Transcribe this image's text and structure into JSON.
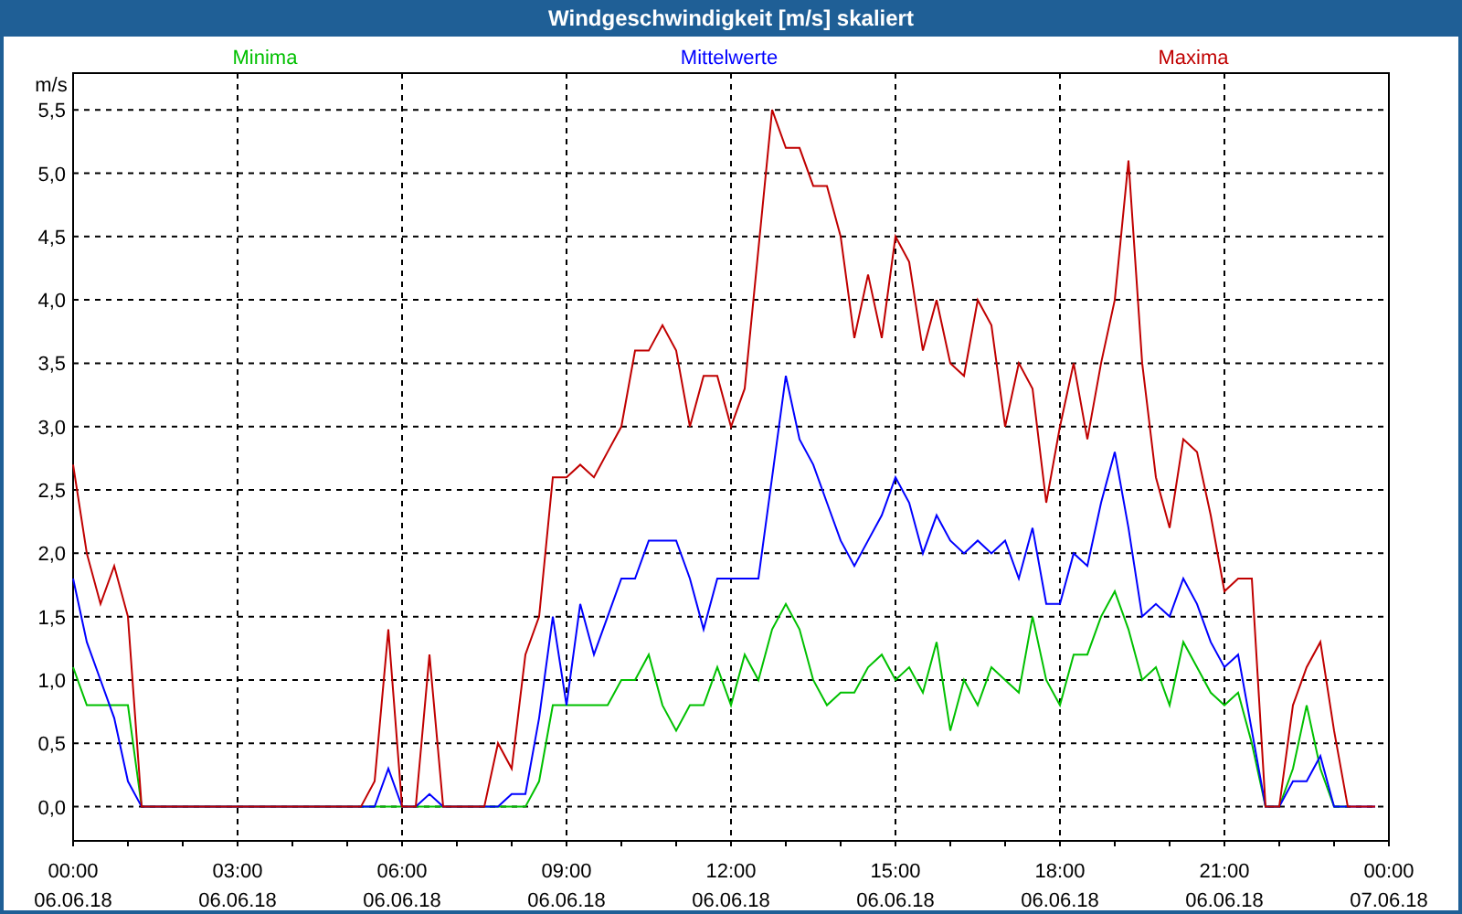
{
  "window": {
    "title": "Windgeschwindigkeit [m/s] skaliert"
  },
  "chart": {
    "chart_data": {
      "type": "line",
      "ylabel": "m/s",
      "categories": [
        "00:00\n06.06.18",
        null,
        null,
        null,
        null,
        null,
        null,
        null,
        null,
        null,
        null,
        null,
        "03:00\n06.06.18",
        null,
        null,
        null,
        null,
        null,
        null,
        null,
        null,
        null,
        null,
        null,
        "06:00\n06.06.18",
        null,
        null,
        null,
        null,
        null,
        null,
        null,
        null,
        null,
        null,
        null,
        "09:00\n06.06.18",
        null,
        null,
        null,
        null,
        null,
        null,
        null,
        null,
        null,
        null,
        null,
        "12:00\n06.06.18",
        null,
        null,
        null,
        null,
        null,
        null,
        null,
        null,
        null,
        null,
        null,
        "15:00\n06.06.18",
        null,
        null,
        null,
        null,
        null,
        null,
        null,
        null,
        null,
        null,
        null,
        "18:00\n06.06.18",
        null,
        null,
        null,
        null,
        null,
        null,
        null,
        null,
        null,
        null,
        null,
        "21:00\n06.06.18",
        null,
        null,
        null,
        null,
        null,
        null,
        null,
        null,
        null,
        null,
        null,
        "00:00\n07.06.18"
      ],
      "series": [
        {
          "name": "Minima",
          "color": "#00c000",
          "values": [
            1.1,
            0.8,
            0.8,
            0.8,
            0.8,
            0,
            0,
            0,
            0,
            0,
            0,
            0,
            0,
            0,
            0,
            0,
            0,
            0,
            0,
            0,
            0,
            0,
            0,
            0,
            0,
            0,
            0,
            0,
            0,
            0,
            0,
            0,
            0,
            0,
            0.2,
            0.8,
            0.8,
            0.8,
            0.8,
            0.8,
            1.0,
            1.0,
            1.2,
            0.8,
            0.6,
            0.8,
            0.8,
            1.1,
            0.8,
            1.2,
            1.0,
            1.4,
            1.6,
            1.4,
            1.0,
            0.8,
            0.9,
            0.9,
            1.1,
            1.2,
            1.0,
            1.1,
            0.9,
            1.3,
            0.6,
            1.0,
            0.8,
            1.1,
            1.0,
            0.9,
            1.5,
            1.0,
            0.8,
            1.2,
            1.2,
            1.5,
            1.7,
            1.4,
            1.0,
            1.1,
            0.8,
            1.3,
            1.1,
            0.9,
            0.8,
            0.9,
            0.5,
            0,
            0,
            0.3,
            0.8,
            0.3,
            0,
            0,
            null,
            null,
            null
          ]
        },
        {
          "name": "Mittelwerte",
          "color": "#0000ff",
          "values": [
            1.8,
            1.3,
            1.0,
            0.7,
            0.2,
            0,
            0,
            0,
            0,
            0,
            0,
            0,
            0,
            0,
            0,
            0,
            0,
            0,
            0,
            0,
            0,
            0,
            0,
            0.3,
            0,
            0,
            0.1,
            0,
            0,
            0,
            0,
            0,
            0.1,
            0.1,
            0.7,
            1.5,
            0.8,
            1.6,
            1.2,
            1.5,
            1.8,
            1.8,
            2.1,
            2.1,
            2.1,
            1.8,
            1.4,
            1.8,
            1.8,
            1.8,
            1.8,
            2.6,
            3.4,
            2.9,
            2.7,
            2.4,
            2.1,
            1.9,
            2.1,
            2.3,
            2.6,
            2.4,
            2.0,
            2.3,
            2.1,
            2.0,
            2.1,
            2.0,
            2.1,
            1.8,
            2.2,
            1.6,
            1.6,
            2.0,
            1.9,
            2.4,
            2.8,
            2.2,
            1.5,
            1.6,
            1.5,
            1.8,
            1.6,
            1.3,
            1.1,
            1.2,
            0.6,
            0,
            0,
            0.2,
            0.2,
            0.4,
            0,
            0,
            0,
            0,
            null
          ]
        },
        {
          "name": "Maxima",
          "color": "#c00000",
          "values": [
            2.7,
            2.0,
            1.6,
            1.9,
            1.5,
            0,
            0,
            0,
            0,
            0,
            0,
            0,
            0,
            0,
            0,
            0,
            0,
            0,
            0,
            0,
            0,
            0,
            0.2,
            1.4,
            0,
            0,
            1.2,
            0,
            0,
            0,
            0,
            0.5,
            0.3,
            1.2,
            1.5,
            2.6,
            2.6,
            2.7,
            2.6,
            2.8,
            3.0,
            3.6,
            3.6,
            3.8,
            3.6,
            3.0,
            3.4,
            3.4,
            3.0,
            3.3,
            4.4,
            5.5,
            5.2,
            5.2,
            4.9,
            4.9,
            4.5,
            3.7,
            4.2,
            3.7,
            4.5,
            4.3,
            3.6,
            4.0,
            3.5,
            3.4,
            4.0,
            3.8,
            3.0,
            3.5,
            3.3,
            2.4,
            3.0,
            3.5,
            2.9,
            3.5,
            4.0,
            5.1,
            3.5,
            2.6,
            2.2,
            2.9,
            2.8,
            2.3,
            1.7,
            1.8,
            1.8,
            0,
            0,
            0.8,
            1.1,
            1.3,
            0.6,
            0,
            0,
            0,
            null
          ]
        }
      ],
      "ylim": [
        -0.27,
        5.79
      ],
      "grid": true,
      "yticks": [
        {
          "value": 0,
          "label": "0,0"
        },
        {
          "value": 0.5,
          "label": "0,5"
        },
        {
          "value": 1,
          "label": "1,0"
        },
        {
          "value": 1.5,
          "label": "1,5"
        },
        {
          "value": 2,
          "label": "2,0"
        },
        {
          "value": 2.5,
          "label": "2,5"
        },
        {
          "value": 3,
          "label": "3,0"
        },
        {
          "value": 3.5,
          "label": "3,5"
        },
        {
          "value": 4,
          "label": "4,0"
        },
        {
          "value": 4.5,
          "label": "4,5"
        },
        {
          "value": 5,
          "label": "5,0"
        },
        {
          "value": 5.5,
          "label": "5,5"
        }
      ]
    }
  }
}
